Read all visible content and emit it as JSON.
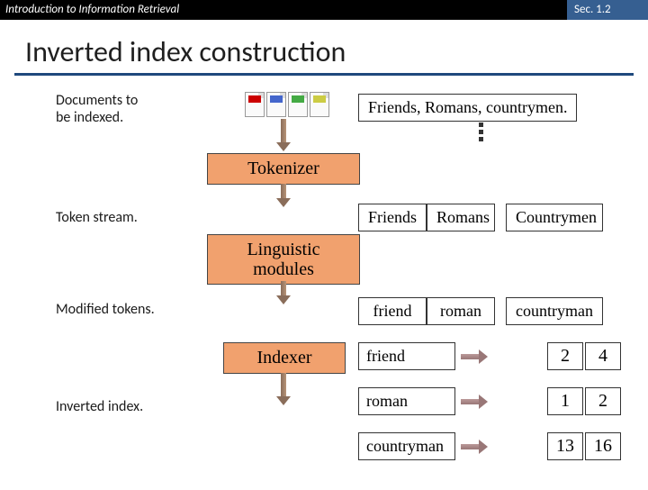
{
  "header": {
    "left": "Introduction to Information Retrieval",
    "right": "Sec. 1.2"
  },
  "title": "Inverted index construction",
  "labels": {
    "documents": "Documents to\nbe indexed.",
    "token_stream": "Token stream.",
    "modified_tokens": "Modified tokens.",
    "inverted_index": "Inverted index."
  },
  "sentence": "Friends, Romans, countrymen.",
  "stages": {
    "tokenizer": "Tokenizer",
    "linguistic": "Linguistic\nmodules",
    "indexer": "Indexer"
  },
  "tokens_raw": [
    "Friends",
    "Romans",
    "Countrymen"
  ],
  "tokens_mod": [
    "friend",
    "roman",
    "countryman"
  ],
  "postings": [
    {
      "term": "friend",
      "ids": [
        "2",
        "4"
      ]
    },
    {
      "term": "roman",
      "ids": [
        "1",
        "2"
      ]
    },
    {
      "term": "countryman",
      "ids": [
        "13",
        "16"
      ]
    }
  ]
}
